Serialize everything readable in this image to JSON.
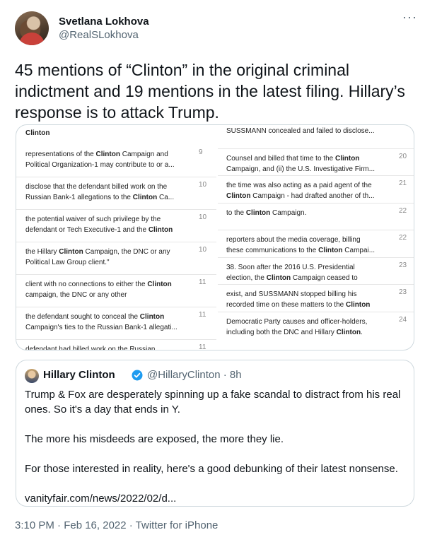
{
  "author": {
    "name": "Svetlana Lokhova",
    "handle": "@RealSLokhova"
  },
  "more_icon": "more-horizontal-icon",
  "tweet_text": "45 mentions of “Clinton” in the original criminal indictment and 19 mentions in the latest filing. Hillary’s response is to attack Trump.",
  "media": {
    "heading": "Clinton",
    "left_rows": [
      {
        "l1": "representations of the Clinton Campaign and",
        "l2": "Political Organization-1 may contribute to or a...",
        "num": "9"
      },
      {
        "l1": "disclose that the defendant billed work on the",
        "l2": "Russian Bank-1 allegations to the Clinton Ca...",
        "num": "10"
      },
      {
        "l1": "the potential waiver of such privilege by the",
        "l2": "defendant or Tech Executive-1 and the Clinton",
        "num": "10"
      },
      {
        "l1": "the Hillary Clinton Campaign, the DNC or any",
        "l2": "Political Law Group client.\"",
        "num": "10"
      },
      {
        "l1": "client with no connections to either the Clinton",
        "l2": "campaign, the DNC or any other",
        "num": "11"
      },
      {
        "l1": "the defendant sought to conceal the Clinton",
        "l2": "Campaign's ties to the Russian Bank-1 allegati...",
        "num": "11"
      },
      {
        "l1": "defendant had billed work on the Russian",
        "l2": "",
        "num": "11"
      }
    ],
    "right_rows": [
      {
        "l1": "SUSSMANN concealed and failed to disclose...",
        "l2": "",
        "num": ""
      },
      {
        "l1": "Counsel and billed that time to the Clinton",
        "l2": "Campaign, and (ii) the U.S. Investigative Firm...",
        "num": "20"
      },
      {
        "l1": "the time was also acting as a paid agent of the",
        "l2": "Clinton Campaign - had drafted another of th...",
        "num": "21"
      },
      {
        "l1": "to the Clinton Campaign.",
        "l2": "",
        "num": "22"
      },
      {
        "l1": "reporters about the media coverage, billing",
        "l2": "these communications to the Clinton Campai...",
        "num": "22"
      },
      {
        "l1": "38. Soon after the 2016 U.S. Presidential",
        "l2": "election, the Clinton Campaign ceased to",
        "num": "23"
      },
      {
        "l1": "exist, and SUSSMANN stopped billing his",
        "l2": "recorded time on these matters to the Clinton",
        "num": "23"
      },
      {
        "l1": "Democratic Party causes and officer-holders,",
        "l2": "including both the DNC and Hillary Clinton.",
        "num": "24"
      }
    ]
  },
  "quote": {
    "name": "Hillary Clinton",
    "handle_time": "@HillaryClinton · 8h",
    "paragraphs": [
      "Trump & Fox are desperately spinning up a fake scandal to distract from his real ones. So it's a day that ends in Y.",
      "The more his misdeeds are exposed, the more they lie.",
      "For those interested in reality, here's a good debunking of their latest nonsense.",
      "vanityfair.com/news/2022/02/d..."
    ]
  },
  "timestamp": "3:10 PM · Feb 16, 2022 · Twitter for iPhone",
  "colors": {
    "text": "#0f1419",
    "secondary": "#536471",
    "border": "#cfd9de",
    "verified": "#1d9bf0"
  }
}
